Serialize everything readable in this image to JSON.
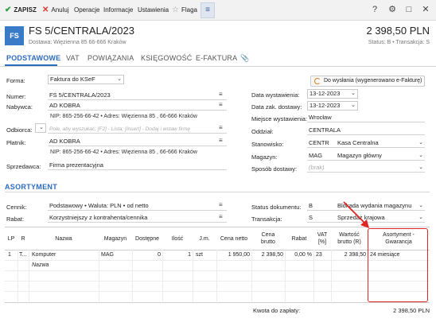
{
  "toolbar": {
    "save": "ZAPISZ",
    "cancel": "Anuluj",
    "operations": "Operacje",
    "info": "Informacje",
    "settings": "Ustawienia",
    "flag": "Flaga",
    "menu_icon": "≡",
    "help_icon": "?",
    "gear_icon": "⚙",
    "maximize_icon": "□",
    "close_icon": "✕"
  },
  "header": {
    "badge": "FS",
    "title": "FS 5/CENTRALA/2023",
    "delivery": "Dostawa: Więzienna  85  66-666 Kraków",
    "amount": "2 398,50 PLN",
    "status": "Status: B  •  Transakcja: S"
  },
  "tabs": [
    "PODSTAWOWE",
    "VAT",
    "POWIĄZANIA",
    "KSIĘGOWOŚĆ",
    "E-FAKTURA"
  ],
  "form": {
    "forma_label": "Forma:",
    "forma_value": "Faktura do KSeF",
    "numer_label": "Numer:",
    "numer_value": "FS 5/CENTRALA/2023",
    "nabywca_label": "Nabywca:",
    "nabywca_value": "AD KOBRA",
    "nabywca_addr": "NIP: 865-256-66-42  •  Adres: Więzienna  85 , 66-666 Kraków",
    "odbiorca_label": "Odbiorca:",
    "odbiorca_placeholder": "Pole, aby wyszukać; [F2] - Lista; [Insert] - Dodaj i wstaw firmę",
    "platnik_label": "Płatnik:",
    "platnik_value": "AD KOBRA",
    "platnik_addr": "NIP: 865-256-66-42  •  Adres: Więzienna  85 , 66-666 Kraków",
    "sprzedawca_label": "Sprzedawca:",
    "sprzedawca_value": "Firma prezentacyjna",
    "status_button": "Do wysłania (wygenerowano e-Fakturę)",
    "data_wyst_label": "Data wystawienia:",
    "data_wyst_value": "13-12-2023",
    "data_zak_label": "Data zak. dostawy:",
    "data_zak_value": "13-12-2023",
    "miejsce_label": "Miejsce wystawienia:",
    "miejsce_value": "Wrocław",
    "oddzial_label": "Oddział:",
    "oddzial_value": "CENTRALA",
    "stanowisko_label": "Stanowisko:",
    "stanowisko_code": "CENTR",
    "stanowisko_name": "Kasa Centralna",
    "magazyn_label": "Magazyn:",
    "magazyn_code": "MAG",
    "magazyn_name": "Magazyn główny",
    "sposob_label": "Sposób dostawy:",
    "sposob_placeholder": "(brak)"
  },
  "asortyment": {
    "title": "ASORTYMENT",
    "cennik_label": "Cennik:",
    "cennik_value": "Podstawowy • Waluta: PLN • od netto",
    "rabat_label": "Rabat:",
    "rabat_value": "Korzystniejszy z kontrahenta/cennika",
    "status_dok_label": "Status dokumentu:",
    "status_dok_code": "B",
    "status_dok_value": "Blokada wydania magazynu",
    "transakcja_label": "Transakcja:",
    "transakcja_code": "S",
    "transakcja_value": "Sprzedaż krajowa"
  },
  "table": {
    "headers": [
      "LP",
      "R",
      "Nazwa",
      "Magazyn",
      "Dostępne",
      "Ilość",
      "J.m.",
      "Cena netto",
      "Cena brutto",
      "Rabat",
      "VAT [%]",
      "Wartość brutto (R)",
      "Asortyment - Gwarancja"
    ],
    "row": {
      "lp": "1",
      "r": "T...",
      "nazwa": "Komputer",
      "magazyn": "MAG",
      "dostepne": "0",
      "ilosc": "1",
      "jm": "szt",
      "cena_netto": "1 950,00",
      "cena_brutto": "2 398,50",
      "rabat": "0,00 %",
      "vat": "23",
      "wartosc": "2 398,50",
      "gwarancja": "24 miesiące"
    },
    "new_row_placeholder": "Nazwa"
  },
  "footer": {
    "kwota_label": "Kwota do zapłaty:",
    "kwota_value": "2 398,50 PLN"
  },
  "colors": {
    "accent": "#2b6bbf",
    "save_green": "#2e9a3e",
    "cancel_red": "#d63a2e",
    "highlight_red": "#e02525"
  }
}
